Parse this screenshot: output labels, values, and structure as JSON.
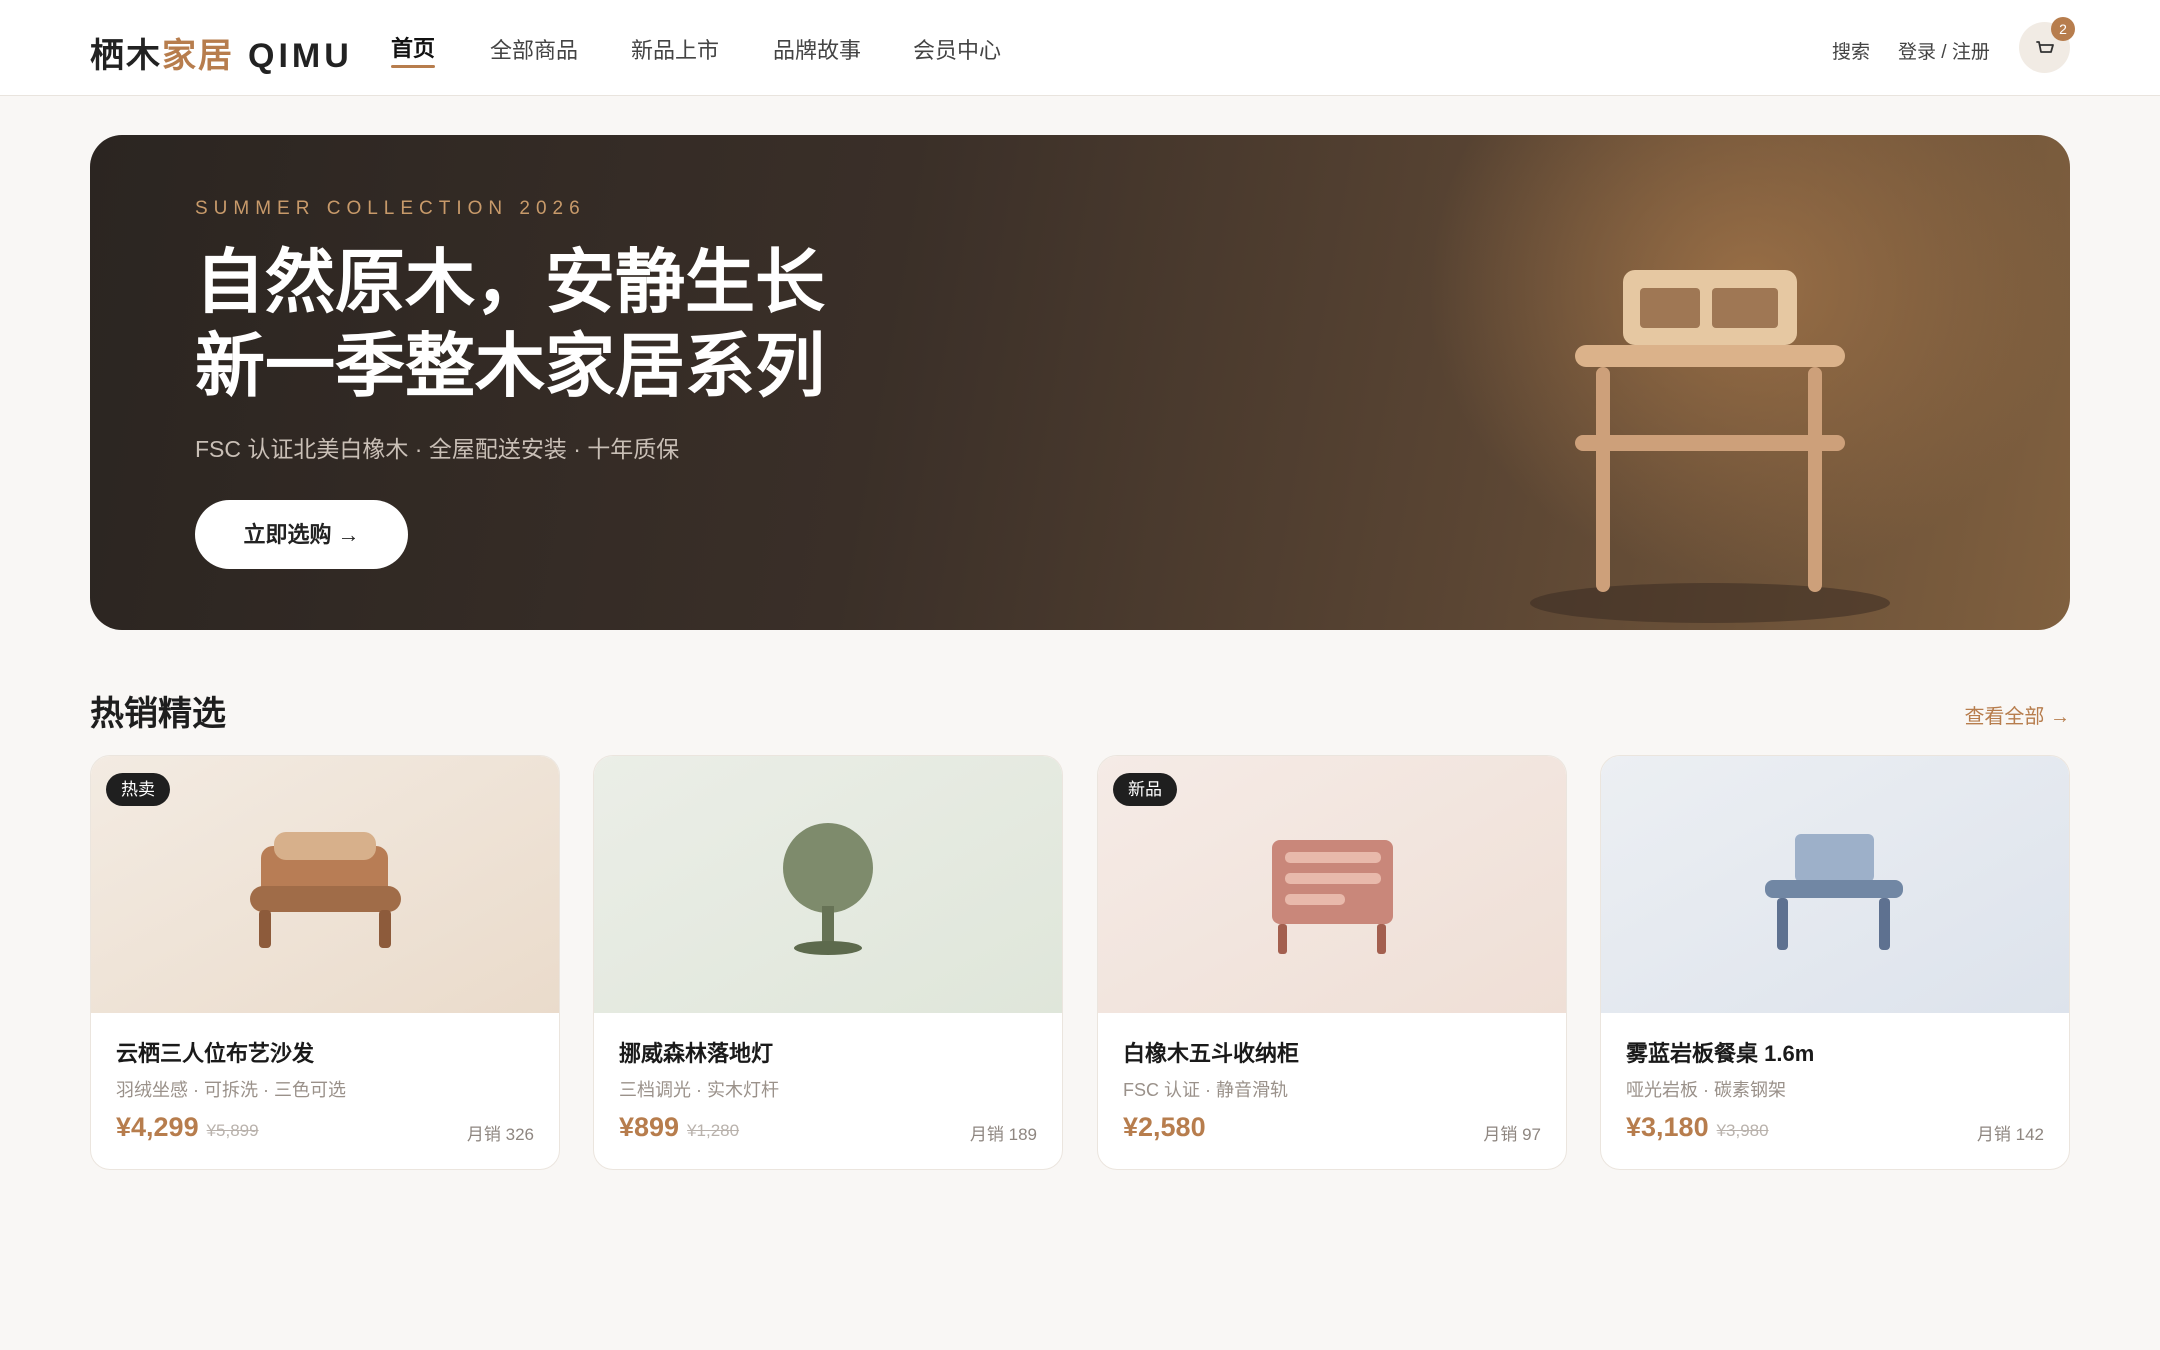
{
  "logo": {
    "part1": "栖木",
    "part2": "家居",
    "latin": "QIMU"
  },
  "nav": [
    {
      "label": "首页",
      "active": true
    },
    {
      "label": "全部商品",
      "active": false
    },
    {
      "label": "新品上市",
      "active": false
    },
    {
      "label": "品牌故事",
      "active": false
    },
    {
      "label": "会员中心",
      "active": false
    }
  ],
  "header": {
    "search_label": "搜索",
    "login_label": "登录 / 注册",
    "cart_count": "2",
    "cart_icon": "cart-icon"
  },
  "hero": {
    "eyebrow": "SUMMER COLLECTION 2026",
    "title_line1": "自然原木，安静生长",
    "title_line2": "新一季整木家居系列",
    "subtitle": "FSC 认证北美白橡木 · 全屋配送安装 · 十年质保",
    "cta_label": "立即选购 →"
  },
  "section": {
    "title": "热销精选",
    "view_all": "查看全部 →"
  },
  "products": [
    {
      "badge": "热卖",
      "name": "云栖三人位布艺沙发",
      "desc": "羽绒坐感 · 可拆洗 · 三色可选",
      "price": "¥4,299",
      "old_price": "¥5,899",
      "sales": "月销 326",
      "illustration": "sofa"
    },
    {
      "badge": "",
      "name": "挪威森林落地灯",
      "desc": "三档调光 · 实木灯杆",
      "price": "¥899",
      "old_price": "¥1,280",
      "sales": "月销 189",
      "illustration": "lamp"
    },
    {
      "badge": "新品",
      "name": "白橡木五斗收纳柜",
      "desc": "FSC 认证 · 静音滑轨",
      "price": "¥2,580",
      "old_price": "",
      "sales": "月销 97",
      "illustration": "cabinet"
    },
    {
      "badge": "",
      "name": "雾蓝岩板餐桌 1.6m",
      "desc": "哑光岩板 · 碳素钢架",
      "price": "¥3,180",
      "old_price": "¥3,980",
      "sales": "月销 142",
      "illustration": "table"
    }
  ],
  "colors": {
    "accent": "#b77d4d",
    "hero_dark": "#2b2521",
    "badge_bg": "#1f1f1f"
  }
}
